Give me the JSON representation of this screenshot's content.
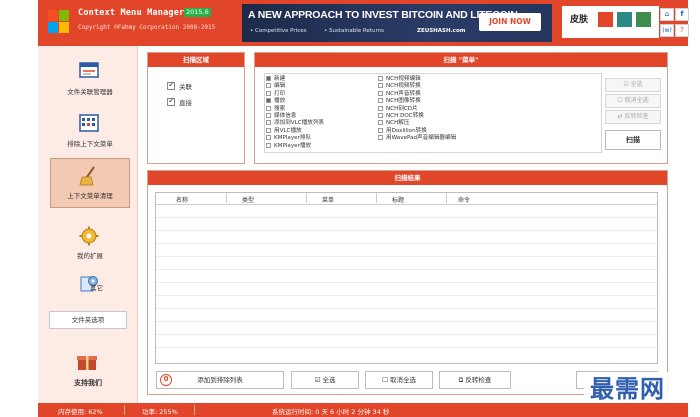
{
  "app": {
    "title": "Context Menu Manager",
    "version": "2015.6",
    "copyright": "Copyright ©Fahmy Corporation 2008-2015"
  },
  "banner": {
    "headline": "A NEW APPROACH TO INVEST BITCOIN AND LITECOIN",
    "bullet1": "• Competitive Prices",
    "bullet2": "• Sustainable Returns",
    "brand": "ZEUSHASH.com",
    "cta": "JOIN NOW"
  },
  "skin": {
    "label": "皮肤",
    "colors": [
      "#e2462a",
      "#2c8a86",
      "#3e8e4f"
    ]
  },
  "sidebar": {
    "items": [
      {
        "label": "文件关联管理器",
        "icon": "file-association-icon"
      },
      {
        "label": "排除上下文菜单",
        "icon": "exclude-menu-icon"
      },
      {
        "label": "上下文菜单清理",
        "icon": "broom-icon",
        "active": true
      },
      {
        "label": "我的扩展",
        "icon": "gear-extension-icon"
      },
      {
        "label": "其它",
        "icon": "other-tools-icon"
      }
    ],
    "file_options": "文件夹选项",
    "support": "支持我们"
  },
  "scan_area": {
    "title": "扫描区域",
    "options": [
      {
        "label": "关联",
        "checked": true
      },
      {
        "label": "直接",
        "checked": true
      }
    ]
  },
  "scan_menu": {
    "title": "扫描 \"菜单\"",
    "col1": [
      {
        "label": "新建",
        "checked": true
      },
      {
        "label": "编辑",
        "checked": false
      },
      {
        "label": "打印",
        "checked": false
      },
      {
        "label": "播放",
        "checked": true
      },
      {
        "label": "搜索",
        "checked": false
      },
      {
        "label": "媒体信息",
        "checked": false
      },
      {
        "label": "添加到VLC播放列表",
        "checked": false
      },
      {
        "label": "用VLC播放",
        "checked": false
      },
      {
        "label": "KMPlayer排队",
        "checked": false
      },
      {
        "label": "KMPlayer播放",
        "checked": false
      }
    ],
    "col2": [
      {
        "label": "NCH视频编辑",
        "checked": false
      },
      {
        "label": "NCH视频转换",
        "checked": false
      },
      {
        "label": "NCH声音转换",
        "checked": false
      },
      {
        "label": "NCH图像转换",
        "checked": false
      },
      {
        "label": "NCH刻CD片",
        "checked": false
      },
      {
        "label": "NCH DOC转换",
        "checked": false
      },
      {
        "label": "NCH解压",
        "checked": false
      },
      {
        "label": "用Doxillion转换",
        "checked": false
      },
      {
        "label": "用WavePad声音编辑器编辑",
        "checked": false
      }
    ],
    "select_all": "全选",
    "deselect_all": "取消全选",
    "invert": "反转检查",
    "scan": "扫描"
  },
  "results": {
    "title": "扫描结果",
    "columns": [
      "名称",
      "类型",
      "菜单",
      "标题",
      "命令"
    ],
    "add_to_exclude": "添加到排除列表",
    "select_all": "全选",
    "deselect_all": "取消全选",
    "invert": "反转检查"
  },
  "status": {
    "memory": "内存使用: 62%",
    "power": "功率: 255%",
    "uptime": "系统运行时间: 0 天 6 小时 2 分钟 34 秒"
  },
  "watermark": "最需网"
}
